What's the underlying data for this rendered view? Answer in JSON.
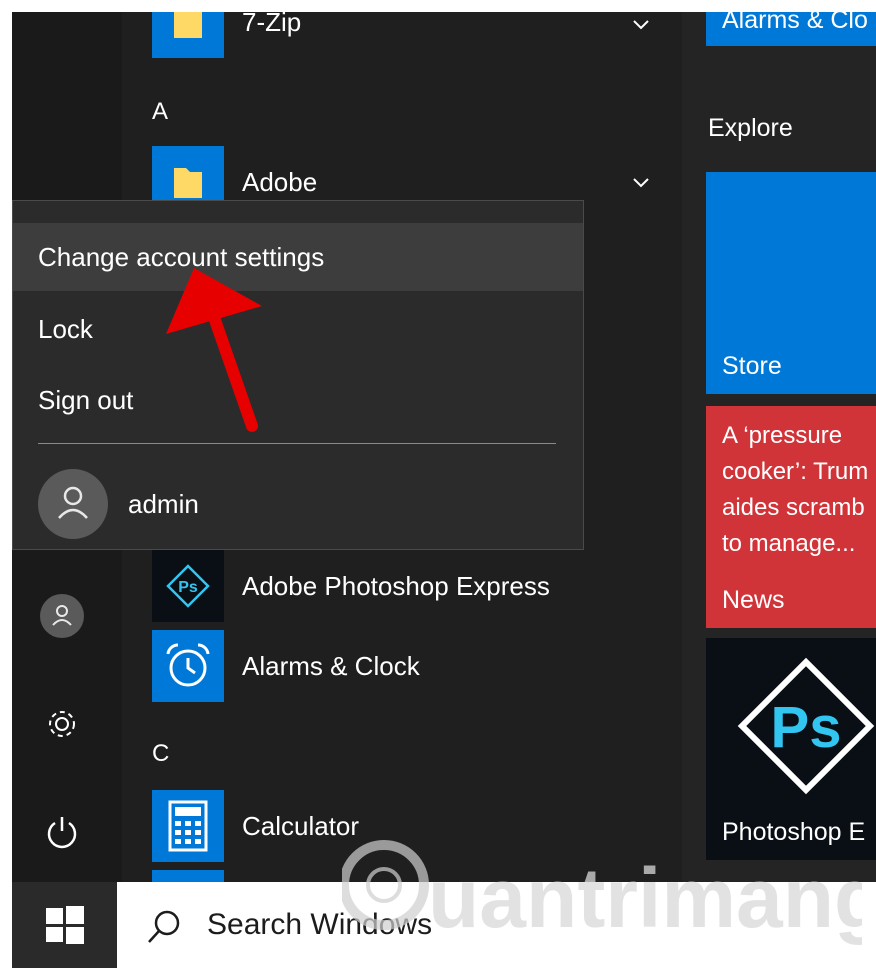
{
  "app_list": {
    "items": [
      {
        "label": "7-Zip",
        "icon": "folder-icon"
      },
      {
        "label": "Adobe",
        "icon": "folder-icon"
      },
      {
        "label": "Adobe Photoshop Express",
        "icon": "photoshop-express-icon"
      },
      {
        "label": "Alarms & Clock",
        "icon": "alarm-clock-icon"
      },
      {
        "label": "Calculator",
        "icon": "calculator-icon"
      }
    ],
    "letters": [
      "A",
      "C"
    ]
  },
  "account_menu": {
    "change_settings": "Change account settings",
    "lock": "Lock",
    "sign_out": "Sign out",
    "user_name": "admin"
  },
  "tiles": {
    "top_tile_label": "Alarms & Clo",
    "section_title": "Explore",
    "store_label": "Store",
    "news_headline": [
      "A ‘pressure",
      "cooker’: Trum",
      "aides scramb",
      "to manage..."
    ],
    "news_label": "News",
    "photoshop_label": "Photoshop E"
  },
  "taskbar": {
    "search_placeholder": "Search Windows"
  },
  "watermark": {
    "text": "uantrimang"
  },
  "colors": {
    "accent_blue": "#0078d7",
    "news_red": "#d13438",
    "annotation_arrow": "#e60000"
  }
}
